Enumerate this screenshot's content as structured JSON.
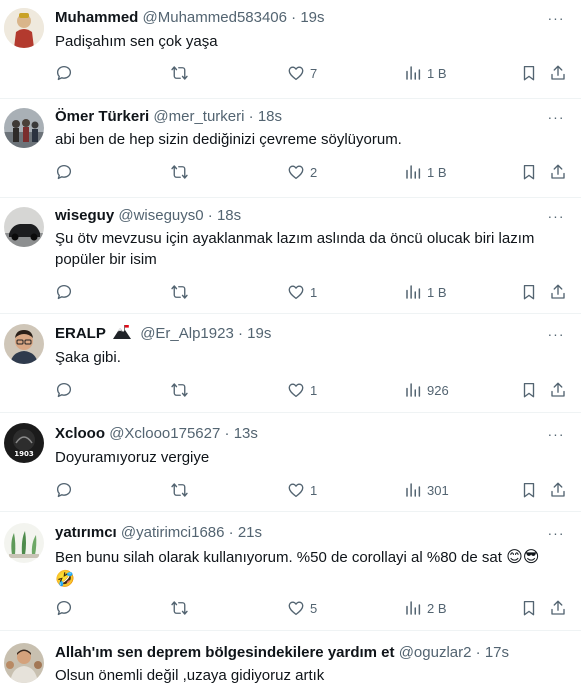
{
  "feed": {
    "more_glyph": "···",
    "tweets": [
      {
        "name": "Muhammed",
        "handle": "@Muhammed583406",
        "dot": "·",
        "time": "19s",
        "text": "Padişahım sen çok yaşa",
        "reply_count": "",
        "retweet_count": "",
        "like_count": "7",
        "views": "1 B",
        "avatar_icon": "avatar-figurine"
      },
      {
        "name": "Ömer Türkeri",
        "handle": "@mer_turkeri",
        "dot": "·",
        "time": "18s",
        "text": "abi ben de hep sizin dediğinizi çevreme söylüyorum.",
        "reply_count": "",
        "retweet_count": "",
        "like_count": "2",
        "views": "1 B",
        "avatar_icon": "avatar-group-photo"
      },
      {
        "name": "wiseguy",
        "handle": "@wiseguys0",
        "dot": "·",
        "time": "18s",
        "text": "Şu ötv mevzusu için ayaklanmak lazım aslında da öncü olucak biri lazım popüler bir isim",
        "reply_count": "",
        "retweet_count": "",
        "like_count": "1",
        "views": "1 B",
        "avatar_icon": "avatar-car"
      },
      {
        "name": "ERALP",
        "name_badge": "mountain-flag-emoji",
        "handle": "@Er_Alp1923",
        "dot": "·",
        "time": "19s",
        "text": "Şaka gibi.",
        "reply_count": "",
        "retweet_count": "",
        "like_count": "1",
        "views": "926",
        "avatar_icon": "avatar-man-glasses"
      },
      {
        "name": "Xclooo",
        "handle": "@Xclooo175627",
        "dot": "·",
        "time": "13s",
        "text": "Doyuramıyoruz vergiye",
        "reply_count": "",
        "retweet_count": "",
        "like_count": "1",
        "views": "301",
        "avatar_icon": "avatar-dark-logo",
        "avatar_text": "1903"
      },
      {
        "name": "yatırımcı",
        "handle": "@yatirimci1686",
        "dot": "·",
        "time": "21s",
        "text": "Ben bunu silah olarak kullanıyorum. %50 de corollayi al %80 de sat",
        "emoji_after_text": "😊😎",
        "emoji_line2": "🤣",
        "reply_count": "",
        "retweet_count": "",
        "like_count": "5",
        "views": "2 B",
        "avatar_icon": "avatar-plants"
      },
      {
        "name": "Allah'ım sen deprem bölgesindekilere yardım et",
        "handle": "@oguzlar2",
        "dot": "·",
        "time": "17s",
        "text": "Olsun önemli değil ,uzaya gidiyoruz artık",
        "avatar_icon": "avatar-crowd"
      }
    ]
  },
  "colors": {
    "text_primary": "#0f1419",
    "text_secondary": "#536471",
    "divider": "#eff3f4"
  }
}
